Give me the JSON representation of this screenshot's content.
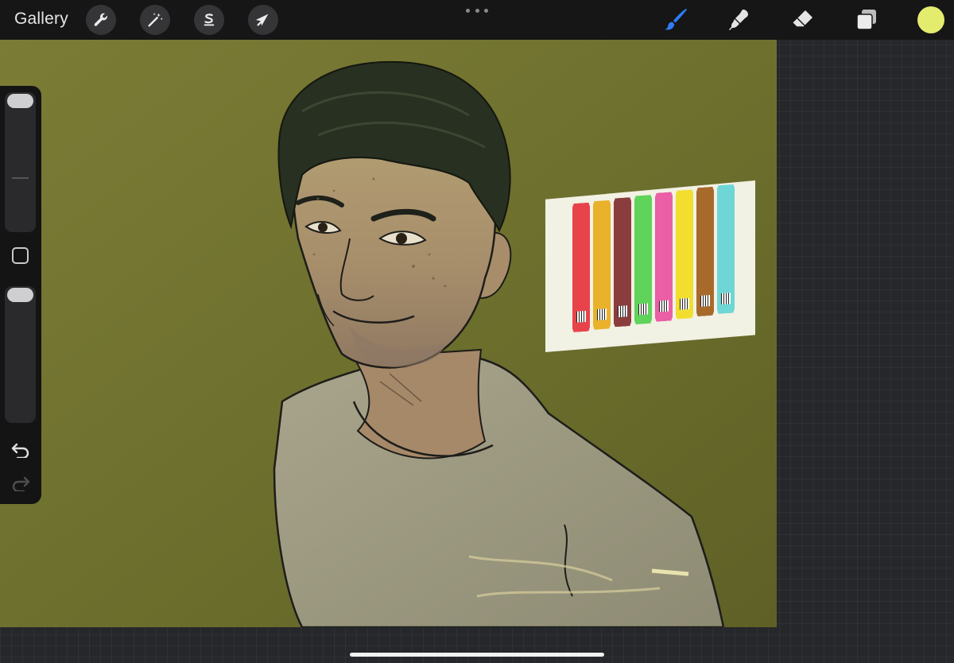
{
  "app": {
    "gallery_label": "Gallery"
  },
  "toolbar": {
    "left_tools": [
      {
        "icon": "wrench-icon",
        "name": "actions"
      },
      {
        "icon": "magic-wand-icon",
        "name": "adjustments"
      },
      {
        "icon": "selection-icon",
        "name": "selection"
      },
      {
        "icon": "arrow-cursor-icon",
        "name": "transform"
      }
    ],
    "more_icon": "more-dots-icon",
    "right_tools": [
      {
        "icon": "brush-icon",
        "name": "brush",
        "active": true
      },
      {
        "icon": "smudge-icon",
        "name": "smudge",
        "active": false
      },
      {
        "icon": "eraser-icon",
        "name": "eraser",
        "active": false
      },
      {
        "icon": "layers-icon",
        "name": "layers",
        "active": false
      }
    ],
    "current_color": "#e4ec6e",
    "active_tool_color": "#2f7cf6"
  },
  "sidebar": {
    "brush_size_slider": {
      "level": 1.0
    },
    "opacity_slider": {
      "level": 1.0
    },
    "modifier_icon": "square-modifier-icon",
    "undo_icon": "undo-icon",
    "redo_icon": "redo-icon"
  },
  "canvas": {
    "background_color": "#6b6e2e",
    "popsicle_colors": [
      "#e8434b",
      "#e9b22a",
      "#8a3d3d",
      "#5fd35a",
      "#ea5fa5",
      "#f1de2e",
      "#a86a2a",
      "#6fd6d6"
    ]
  }
}
